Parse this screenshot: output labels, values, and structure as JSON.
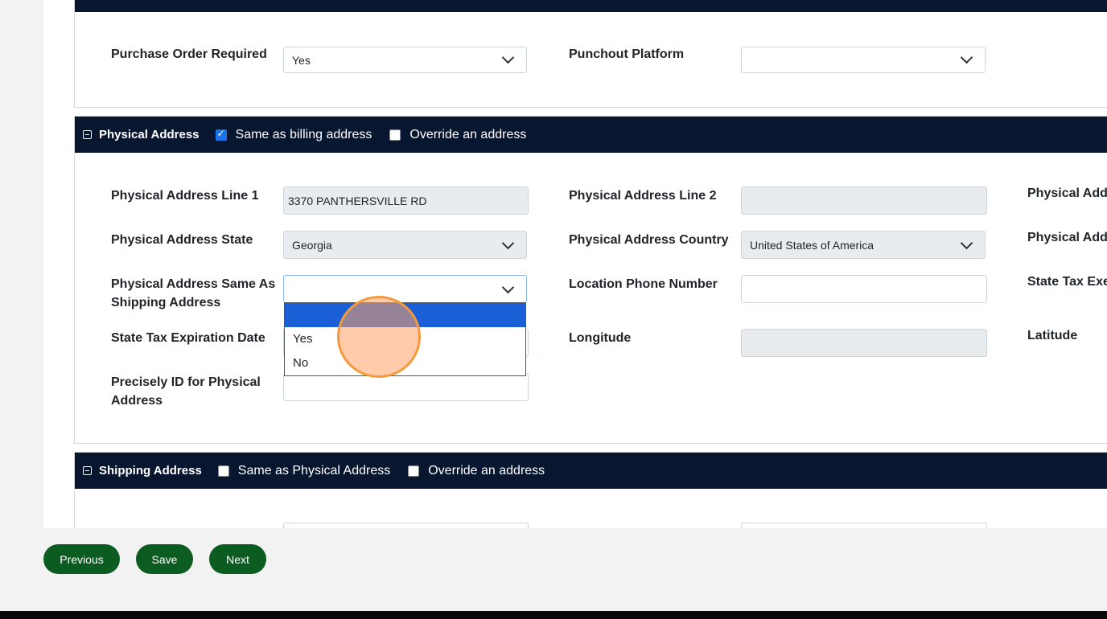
{
  "purchase_section": {
    "po_required_label": "Purchase Order Required",
    "po_required_value": "Yes",
    "punchout_label": "Punchout Platform",
    "punchout_value": ""
  },
  "physical_section": {
    "title": "Physical Address",
    "same_billing_label": "Same as billing address",
    "same_billing_checked": true,
    "override_label": "Override an address",
    "line1_label": "Physical Address Line 1",
    "line1_value": "3370 PANTHERSVILLE RD",
    "line2_label": "Physical Address Line 2",
    "line2_value": "",
    "line3_label_clipped": "Physical Addr",
    "state_label": "Physical Address State",
    "state_value": "Georgia",
    "country_label": "Physical Address Country",
    "country_value": "United States of America",
    "col3_row2_label_clipped": "Physical Addr",
    "same_shipping_label": "Physical Address Same As Shipping Address",
    "same_shipping_value": "",
    "same_shipping_options": [
      "",
      "Yes",
      "No"
    ],
    "location_phone_label": "Location Phone Number",
    "state_tax_exempt_label_clipped": "State Tax Exer",
    "tax_exp_label": "State Tax Expiration Date",
    "longitude_label": "Longitude",
    "latitude_label": "Latitude",
    "precisely_label": "Precisely ID for Physical Address"
  },
  "shipping_section": {
    "title": "Shipping Address",
    "same_physical_label": "Same as Physical Address",
    "override_label": "Override an address"
  },
  "footer": {
    "previous_label": "Previous",
    "save_label": "Save",
    "next_label": "Next"
  }
}
